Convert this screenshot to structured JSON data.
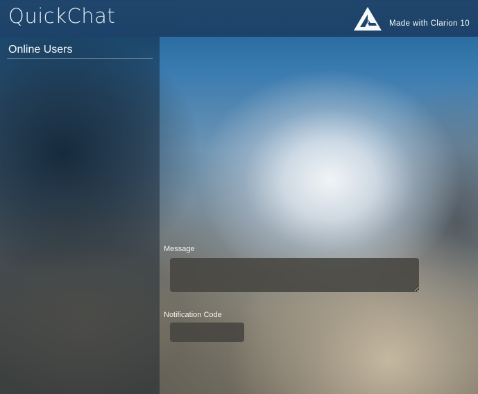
{
  "header": {
    "app_title": "QuickChat",
    "brand_text": "Made with Clarion 10",
    "brand_icon": "clarion-logo-icon"
  },
  "sidebar": {
    "heading": "Online Users",
    "users": []
  },
  "form": {
    "message_label": "Message",
    "message_value": "",
    "notification_code_label": "Notification Code",
    "notification_code_value": ""
  },
  "colors": {
    "header_bg": "#1d4168",
    "input_bg": "#464440",
    "text": "#ffffff"
  }
}
